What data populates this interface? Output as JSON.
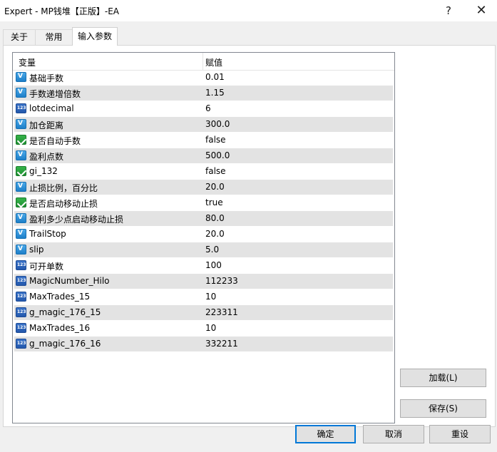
{
  "window": {
    "title": "Expert - MP钱堆【正版】-EA",
    "help_icon": "?",
    "close_icon": "✕"
  },
  "tabs": [
    {
      "label": "关于",
      "active": false
    },
    {
      "label": "常用",
      "active": false
    },
    {
      "label": "输入参数",
      "active": true
    }
  ],
  "grid": {
    "headers": {
      "variable": "变量",
      "value": "赋值"
    },
    "rows": [
      {
        "icon": "vd-icon",
        "name": "基础手数",
        "value": "0.01"
      },
      {
        "icon": "vd-icon",
        "name": "手数递增倍数",
        "value": "1.15"
      },
      {
        "icon": "int-icon",
        "name": "lotdecimal",
        "value": "6"
      },
      {
        "icon": "vd-icon",
        "name": "加仓距离",
        "value": "300.0"
      },
      {
        "icon": "bool-icon",
        "name": "是否自动手数",
        "value": "false"
      },
      {
        "icon": "vd-icon",
        "name": "盈利点数",
        "value": "500.0"
      },
      {
        "icon": "bool-icon",
        "name": "gi_132",
        "value": "false"
      },
      {
        "icon": "vd-icon",
        "name": "止损比例，百分比",
        "value": "20.0"
      },
      {
        "icon": "bool-icon",
        "name": "是否启动移动止损",
        "value": "true"
      },
      {
        "icon": "vd-icon",
        "name": "盈利多少点启动移动止损",
        "value": "80.0"
      },
      {
        "icon": "vd-icon",
        "name": "TrailStop",
        "value": "20.0"
      },
      {
        "icon": "vd-icon",
        "name": "slip",
        "value": "5.0"
      },
      {
        "icon": "int-icon",
        "name": "可开单数",
        "value": "100"
      },
      {
        "icon": "int-icon",
        "name": "MagicNumber_Hilo",
        "value": "112233"
      },
      {
        "icon": "int-icon",
        "name": "MaxTrades_15",
        "value": "10"
      },
      {
        "icon": "int-icon",
        "name": "g_magic_176_15",
        "value": "223311"
      },
      {
        "icon": "int-icon",
        "name": "MaxTrades_16",
        "value": "10"
      },
      {
        "icon": "int-icon",
        "name": "g_magic_176_16",
        "value": "332211"
      }
    ]
  },
  "buttons": {
    "load": "加载(L)",
    "save": "保存(S)",
    "ok": "确定",
    "cancel": "取消",
    "reset": "重设"
  }
}
